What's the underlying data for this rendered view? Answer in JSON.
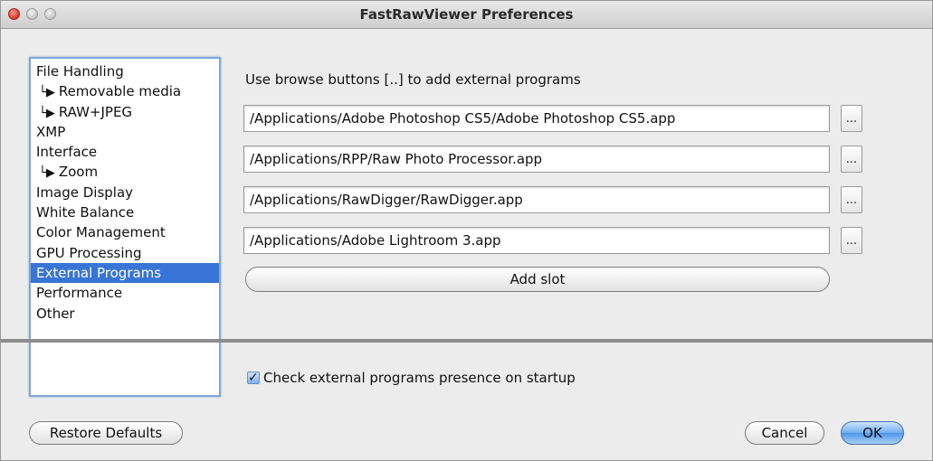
{
  "window": {
    "title": "FastRawViewer Preferences"
  },
  "sidebar": {
    "items": [
      {
        "label": "File Handling",
        "sub": false
      },
      {
        "label": "Removable media",
        "sub": true
      },
      {
        "label": "RAW+JPEG",
        "sub": true
      },
      {
        "label": "XMP",
        "sub": false
      },
      {
        "label": "Interface",
        "sub": false
      },
      {
        "label": "Zoom",
        "sub": true
      },
      {
        "label": "Image Display",
        "sub": false
      },
      {
        "label": "White Balance",
        "sub": false
      },
      {
        "label": "Color Management",
        "sub": false
      },
      {
        "label": "GPU Processing",
        "sub": false
      },
      {
        "label": "External Programs",
        "sub": false,
        "selected": true
      },
      {
        "label": "Performance",
        "sub": false
      },
      {
        "label": "Other",
        "sub": false
      }
    ],
    "sub_arrow": "└▶"
  },
  "main": {
    "heading": "Use browse buttons [..] to add external programs",
    "programs": [
      "/Applications/Adobe Photoshop CS5/Adobe Photoshop CS5.app",
      "/Applications/RPP/Raw Photo Processor.app",
      "/Applications/RawDigger/RawDigger.app",
      "/Applications/Adobe Lightroom 3.app"
    ],
    "browse_label": "...",
    "add_slot_label": "Add slot",
    "check_label": "Check external programs presence on startup",
    "check_checked": true
  },
  "footer": {
    "restore_label": "Restore Defaults",
    "cancel_label": "Cancel",
    "ok_label": "OK"
  },
  "colors": {
    "selection": "#3875d7",
    "focus_ring": "#7fa6d8"
  }
}
